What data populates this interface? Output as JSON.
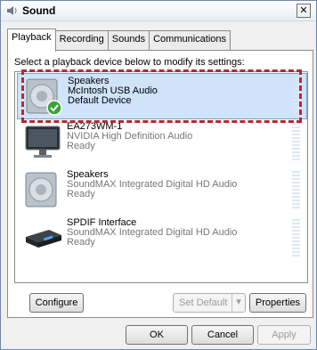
{
  "window": {
    "title": "Sound",
    "close_glyph": "✕"
  },
  "tabs": [
    {
      "label": "Playback",
      "active": true
    },
    {
      "label": "Recording",
      "active": false
    },
    {
      "label": "Sounds",
      "active": false
    },
    {
      "label": "Communications",
      "active": false
    }
  ],
  "instructions": "Select a playback device below to modify its settings:",
  "devices": [
    {
      "name": "Speakers",
      "line2": "McIntosh USB Audio",
      "line3": "Default Device",
      "icon": "speaker-icon",
      "selected": true,
      "default": true
    },
    {
      "name": "EA273WM-1",
      "line2": "NVIDIA High Definition Audio",
      "line3": "Ready",
      "icon": "monitor-icon",
      "selected": false,
      "default": false
    },
    {
      "name": "Speakers",
      "line2": "SoundMAX Integrated Digital HD Audio",
      "line3": "Ready",
      "icon": "speaker-icon",
      "selected": false,
      "default": false
    },
    {
      "name": "SPDIF Interface",
      "line2": "SoundMAX Integrated Digital HD Audio",
      "line3": "Ready",
      "icon": "spdif-icon",
      "selected": false,
      "default": false
    }
  ],
  "buttons": {
    "configure": "Configure",
    "set_default": "Set Default",
    "properties": "Properties",
    "ok": "OK",
    "cancel": "Cancel",
    "apply": "Apply"
  },
  "colors": {
    "selection": "#cfe3f9",
    "highlight_dash": "#b7282e"
  }
}
